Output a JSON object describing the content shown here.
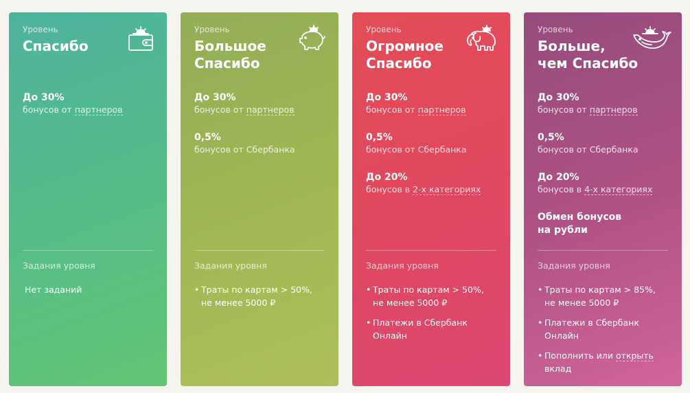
{
  "cards": [
    {
      "level_caption": "Уровень",
      "name_line1": "Спасибо",
      "name_line2": "",
      "icon": "wallet-sun-icon",
      "benefits": [
        {
          "value": "До 30%",
          "desc_prefix": "бонусов от ",
          "desc_link": "партнеров"
        }
      ],
      "tasks_title": "Задания уровня",
      "no_tasks": "Нет заданий"
    },
    {
      "level_caption": "Уровень",
      "name_line1": "Большое",
      "name_line2": "Спасибо",
      "icon": "piggy-bank-icon",
      "benefits": [
        {
          "value": "До 30%",
          "desc_prefix": "бонусов от ",
          "desc_link": "партнеров"
        },
        {
          "value": "0,5%",
          "desc_prefix": "бонусов от Сбербанка",
          "desc_link": ""
        }
      ],
      "tasks_title": "Задания уровня",
      "tasks": [
        {
          "line1": "Траты по картам > 50%,",
          "line2": "не менее 5000 ₽"
        }
      ]
    },
    {
      "level_caption": "Уровень",
      "name_line1": "Огромное",
      "name_line2": "Спасибо",
      "icon": "elephant-icon",
      "benefits": [
        {
          "value": "До 30%",
          "desc_prefix": "бонусов от ",
          "desc_link": "партнеров"
        },
        {
          "value": "0,5%",
          "desc_prefix": "бонусов от Сбербанка",
          "desc_link": ""
        },
        {
          "value": "До 20%",
          "desc_prefix": "бонусов в ",
          "desc_link": "2-х категориях"
        }
      ],
      "tasks_title": "Задания уровня",
      "tasks": [
        {
          "line1": "Траты по картам > 50%,",
          "line2": "не менее 5000 ₽"
        },
        {
          "line1": "Платежи в Сбербанк",
          "line2": "Онлайн"
        }
      ]
    },
    {
      "level_caption": "Уровень",
      "name_line1": "Больше,",
      "name_line2": "чем Спасибо",
      "icon": "whale-icon",
      "benefits": [
        {
          "value": "До 30%",
          "desc_prefix": "бонусов от ",
          "desc_link": "партнеров"
        },
        {
          "value": "0,5%",
          "desc_prefix": "бонусов от Сбербанка",
          "desc_link": ""
        },
        {
          "value": "До 20%",
          "desc_prefix": "бонусов в ",
          "desc_link": "4-х категориях"
        }
      ],
      "extra_line1": "Обмен бонусов",
      "extra_line2": "на рубли",
      "tasks_title": "Задания уровня",
      "tasks": [
        {
          "line1": "Траты по картам > 85%,",
          "line2": "не менее 5000 ₽"
        },
        {
          "line1": "Платежи в Сбербанк",
          "line2": "Онлайн"
        },
        {
          "line1_prefix": "Пополнить или ",
          "line1_link": "открыть",
          "line2": "вклад"
        }
      ]
    }
  ]
}
